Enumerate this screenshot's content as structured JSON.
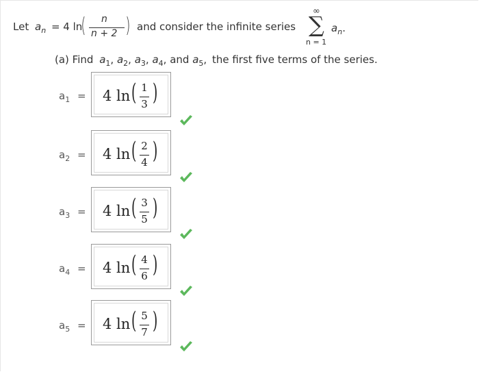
{
  "header": {
    "let": "Let",
    "a": "a",
    "n_sub": "n",
    "equals_four_ln": "= 4 ln",
    "frac_num": "n",
    "frac_den": "n + 2",
    "consider": "and consider the infinite series",
    "infinity": "∞",
    "sigma": "∑",
    "lower_limit": "n = 1",
    "summand": "a",
    "summand_sub": "n",
    "period": "."
  },
  "part_a": {
    "prefix": "(a) Find",
    "a": "a",
    "subs": [
      "1",
      "2",
      "3",
      "4"
    ],
    "and": "and",
    "last_sub": "5",
    "suffix": "the first five terms of the series."
  },
  "answers": [
    {
      "a": "a",
      "sub": "1",
      "eq": "=",
      "coef": "4 ln",
      "num": "1",
      "den": "3",
      "correct": true
    },
    {
      "a": "a",
      "sub": "2",
      "eq": "=",
      "coef": "4 ln",
      "num": "2",
      "den": "4",
      "correct": true
    },
    {
      "a": "a",
      "sub": "3",
      "eq": "=",
      "coef": "4 ln",
      "num": "3",
      "den": "5",
      "correct": true
    },
    {
      "a": "a",
      "sub": "4",
      "eq": "=",
      "coef": "4 ln",
      "num": "4",
      "den": "6",
      "correct": true
    },
    {
      "a": "a",
      "sub": "5",
      "eq": "=",
      "coef": "4 ln",
      "num": "5",
      "den": "7",
      "correct": true
    }
  ],
  "colors": {
    "check": "#5cb85c"
  },
  "icons": {
    "correct": "check-icon"
  }
}
